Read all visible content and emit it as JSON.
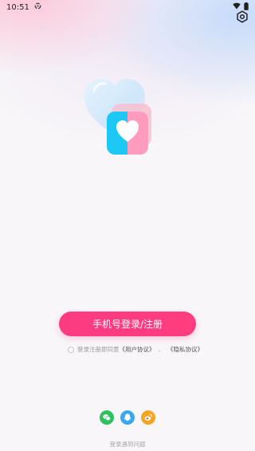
{
  "status_bar": {
    "time": "10:51"
  },
  "login": {
    "button_label": "手机号登录/注册"
  },
  "agreement": {
    "prefix": "登录注册即同意",
    "user_agreement": "《用户协议》",
    "separator": "、",
    "privacy_agreement": "《隐私协议》"
  },
  "social": {
    "items": [
      {
        "icon": "wechat-icon",
        "color": "#2dc25e"
      },
      {
        "icon": "qq-icon",
        "color": "#3aa8f0"
      },
      {
        "icon": "weibo-icon",
        "color": "#f4a623"
      }
    ]
  },
  "footer": {
    "help_label": "登录遇到问题"
  },
  "colors": {
    "accent": "#fb3b80",
    "logo_blue": "#1ec8f5",
    "logo_pink": "#ff9cbd"
  }
}
